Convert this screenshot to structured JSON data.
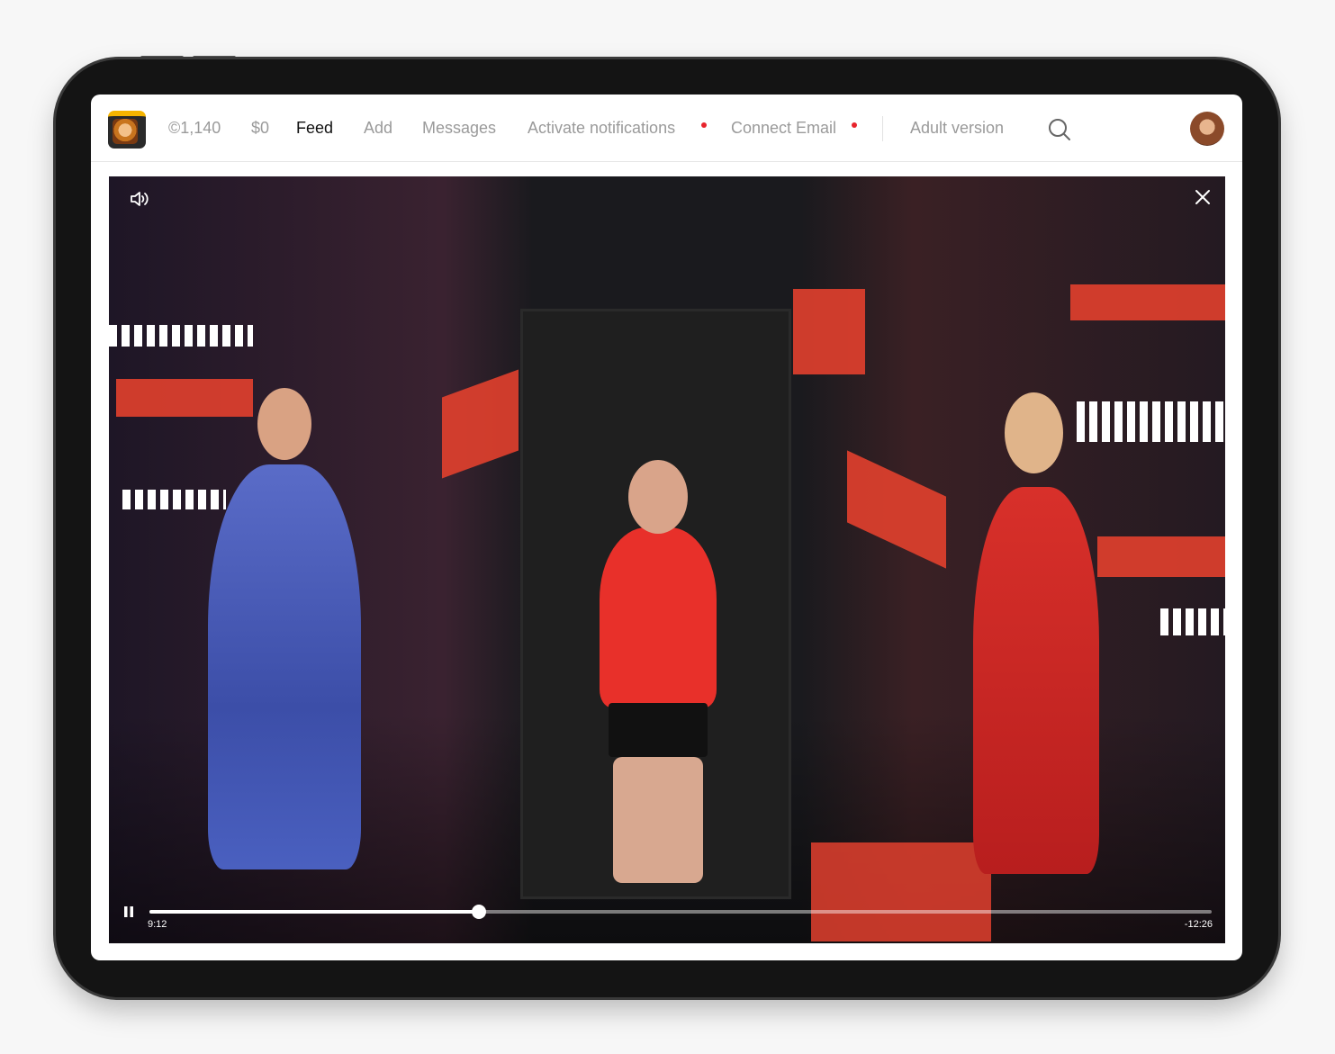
{
  "nav": {
    "coins": "©1,140",
    "balance": "$0",
    "items": [
      {
        "label": "Feed",
        "active": true
      },
      {
        "label": "Add",
        "active": false
      },
      {
        "label": "Messages",
        "active": false
      },
      {
        "label": "Activate notifications",
        "active": false,
        "badge": true
      },
      {
        "label": "Connect Email",
        "active": false,
        "badge": true
      },
      {
        "label": "Adult version",
        "active": false
      }
    ],
    "search_icon": "search-icon",
    "badge_color": "#e8242c"
  },
  "player": {
    "elapsed": "9:12",
    "remaining": "-12:26",
    "progress_fraction": 0.31,
    "icons": [
      "volume-icon",
      "close-icon",
      "pause-icon"
    ]
  }
}
